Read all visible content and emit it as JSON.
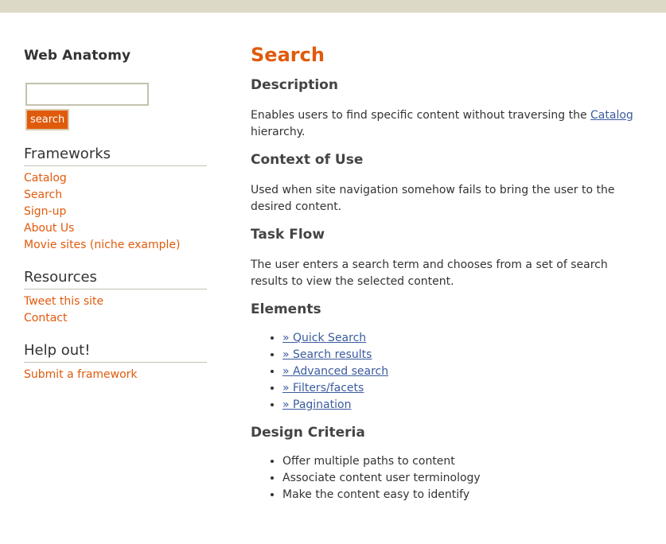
{
  "sidebar": {
    "site_title": "Web Anatomy",
    "search": {
      "input_value": "",
      "button_label": "search"
    },
    "sections": [
      {
        "heading": "Frameworks",
        "links": [
          "Catalog",
          "Search",
          "Sign-up",
          "About Us",
          "Movie sites (niche example)"
        ]
      },
      {
        "heading": "Resources",
        "links": [
          "Tweet this site",
          "Contact"
        ]
      },
      {
        "heading": "Help out!",
        "links": [
          "Submit a framework"
        ]
      }
    ]
  },
  "main": {
    "title": "Search",
    "description": {
      "heading": "Description",
      "text_before": "Enables users to find specific content without traversing the ",
      "link": "Catalog",
      "text_after": " hierarchy."
    },
    "context": {
      "heading": "Context of Use",
      "text": "Used when site navigation somehow fails to bring the user to the desired content."
    },
    "task_flow": {
      "heading": "Task Flow",
      "text": "The user enters a search term and chooses from a set of search results to view the selected content."
    },
    "elements": {
      "heading": "Elements",
      "items": [
        "» Quick Search",
        "» Search results",
        "» Advanced search",
        "» Filters/facets",
        "» Pagination"
      ]
    },
    "design_criteria": {
      "heading": "Design Criteria",
      "items": [
        "Offer multiple paths to content",
        "Associate content user terminology",
        "Make the content easy to identify"
      ]
    }
  },
  "colors": {
    "accent": "#e05a0c",
    "link": "#3b5b9e",
    "topbar": "#dcdac6"
  }
}
